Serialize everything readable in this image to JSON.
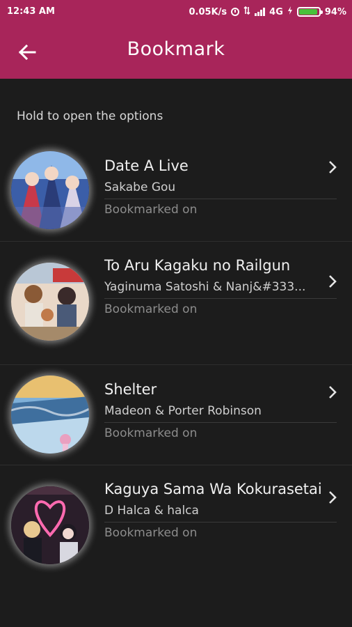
{
  "status": {
    "time": "12:43 AM",
    "speed": "0.05K/s",
    "network": "4G",
    "battery": "94%",
    "battery_level": 0.94
  },
  "header": {
    "title": "Bookmark",
    "back_icon": "arrow-left-icon",
    "color": "#a8255a"
  },
  "hint": "Hold to open the options",
  "items": [
    {
      "title": "Date A Live",
      "artist": "Sakabe Gou",
      "bookmarked": "Bookmarked on"
    },
    {
      "title": "To Aru Kagaku no Railgun",
      "artist": "Yaginuma Satoshi & Nanj&#333...",
      "bookmarked": "Bookmarked on"
    },
    {
      "title": "Shelter",
      "artist": "Madeon & Porter Robinson",
      "bookmarked": "Bookmarked on"
    },
    {
      "title": "Kaguya Sama Wa Kokurasetai",
      "artist": "D Halca & halca",
      "bookmarked": "Bookmarked on"
    }
  ]
}
